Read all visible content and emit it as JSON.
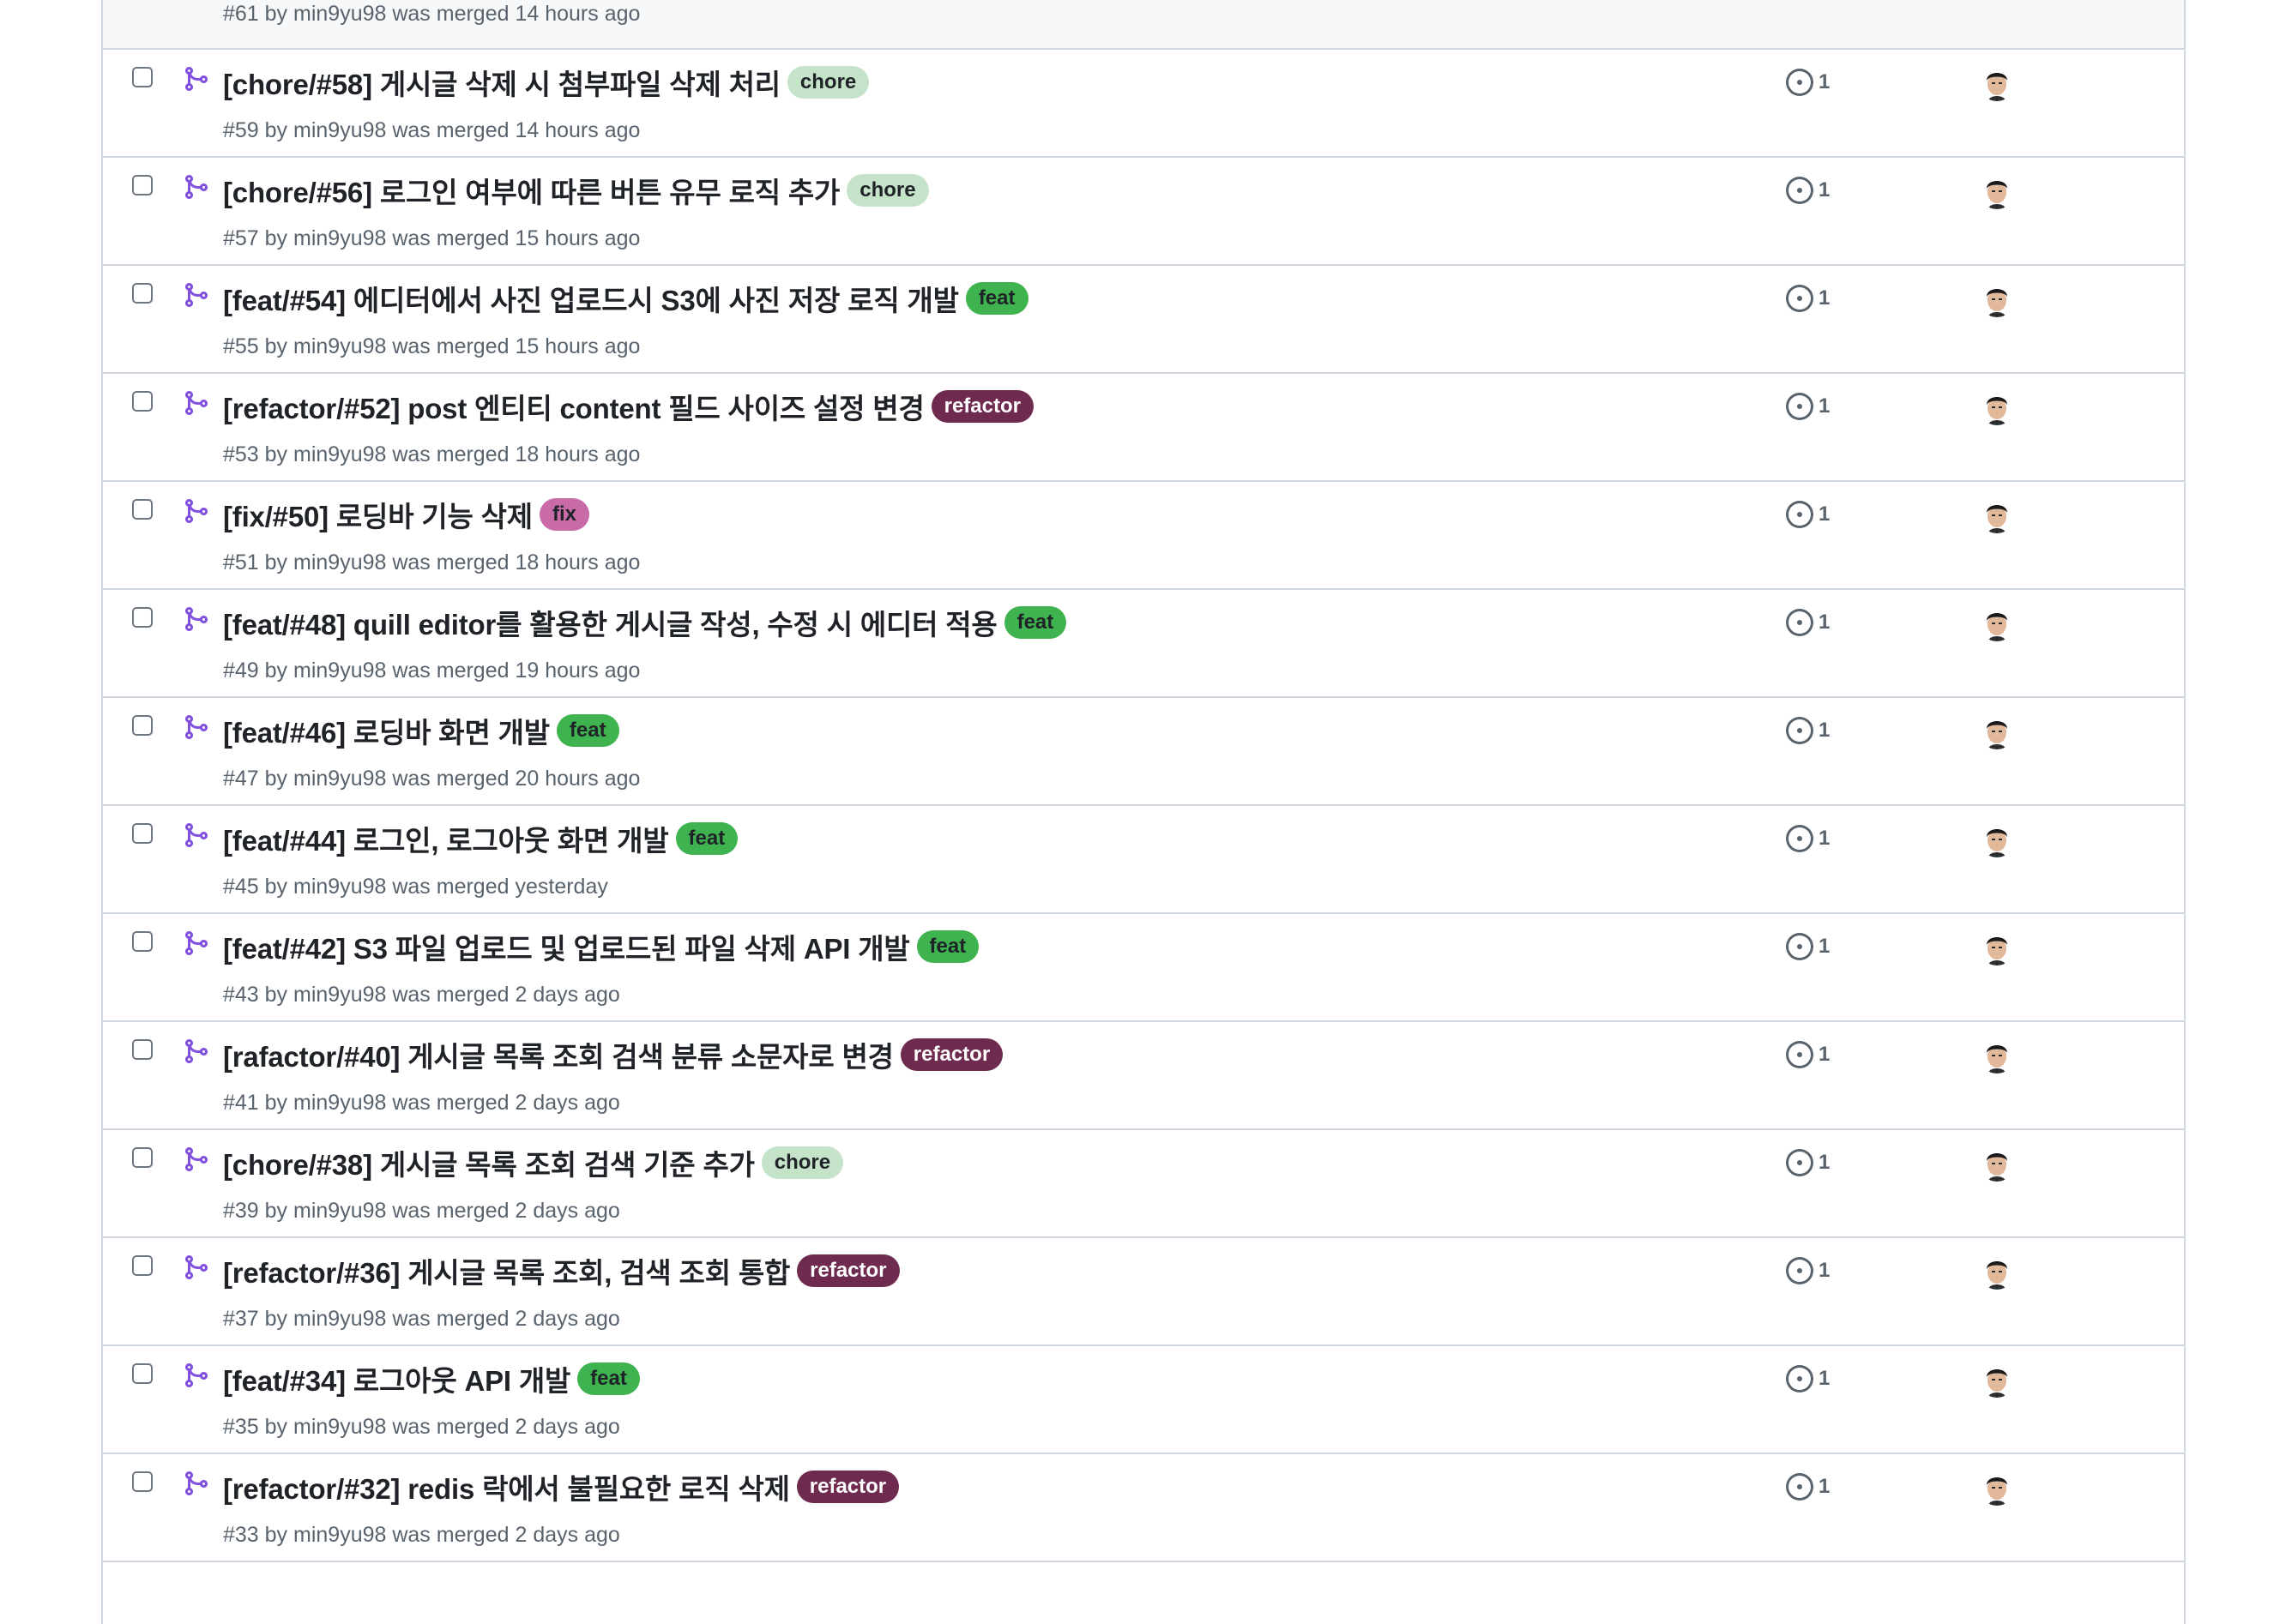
{
  "colors": {
    "merged": "#8250df",
    "chore_bg": "#c5e3c8",
    "chore_fg": "#1f2328",
    "feat_bg": "#3fb34f",
    "feat_fg": "#1f2328",
    "refactor_bg": "#6e2a4f",
    "refactor_fg": "#ffffff",
    "fix_bg": "#c96ba7",
    "fix_fg": "#1f2328"
  },
  "top_row": {
    "meta": "#61 by min9yu98 was merged 14 hours ago"
  },
  "rows": [
    {
      "title": "[chore/#58] 게시글 삭제 시 첨부파일 삭제 처리",
      "label": "chore",
      "meta": "#59 by min9yu98 was merged 14 hours ago",
      "issues": "1"
    },
    {
      "title": "[chore/#56] 로그인 여부에 따른 버튼 유무 로직 추가",
      "label": "chore",
      "meta": "#57 by min9yu98 was merged 15 hours ago",
      "issues": "1"
    },
    {
      "title": "[feat/#54] 에디터에서 사진 업로드시 S3에 사진 저장 로직 개발",
      "label": "feat",
      "meta": "#55 by min9yu98 was merged 15 hours ago",
      "issues": "1"
    },
    {
      "title": "[refactor/#52] post 엔티티 content 필드 사이즈 설정 변경",
      "label": "refactor",
      "meta": "#53 by min9yu98 was merged 18 hours ago",
      "issues": "1"
    },
    {
      "title": "[fix/#50] 로딩바 기능 삭제",
      "label": "fix",
      "meta": "#51 by min9yu98 was merged 18 hours ago",
      "issues": "1"
    },
    {
      "title": "[feat/#48] quill editor를 활용한 게시글 작성, 수정 시 에디터 적용",
      "label": "feat",
      "meta": "#49 by min9yu98 was merged 19 hours ago",
      "issues": "1"
    },
    {
      "title": "[feat/#46] 로딩바 화면 개발",
      "label": "feat",
      "meta": "#47 by min9yu98 was merged 20 hours ago",
      "issues": "1"
    },
    {
      "title": "[feat/#44] 로그인, 로그아웃 화면 개발",
      "label": "feat",
      "meta": "#45 by min9yu98 was merged yesterday",
      "issues": "1"
    },
    {
      "title": "[feat/#42] S3 파일 업로드 및 업로드된 파일 삭제 API 개발",
      "label": "feat",
      "meta": "#43 by min9yu98 was merged 2 days ago",
      "issues": "1"
    },
    {
      "title": "[rafactor/#40] 게시글 목록 조회 검색 분류 소문자로 변경",
      "label": "refactor",
      "meta": "#41 by min9yu98 was merged 2 days ago",
      "issues": "1"
    },
    {
      "title": "[chore/#38] 게시글 목록 조회 검색 기준 추가",
      "label": "chore",
      "meta": "#39 by min9yu98 was merged 2 days ago",
      "issues": "1"
    },
    {
      "title": "[refactor/#36] 게시글 목록 조회, 검색 조회 통합",
      "label": "refactor",
      "meta": "#37 by min9yu98 was merged 2 days ago",
      "issues": "1"
    },
    {
      "title": "[feat/#34] 로그아웃 API 개발",
      "label": "feat",
      "meta": "#35 by min9yu98 was merged 2 days ago",
      "issues": "1"
    },
    {
      "title": "[refactor/#32] redis 락에서 불필요한 로직 삭제",
      "label": "refactor",
      "meta": "#33 by min9yu98 was merged 2 days ago",
      "issues": "1"
    }
  ]
}
